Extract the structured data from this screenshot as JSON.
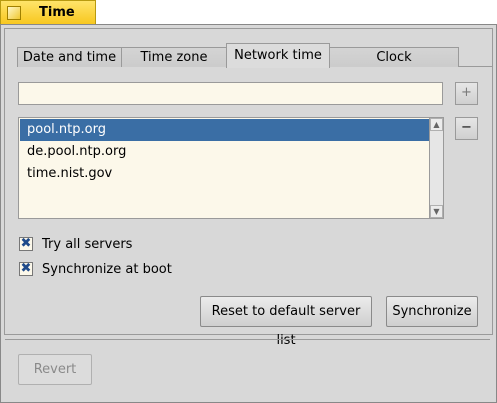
{
  "window": {
    "title": "Time"
  },
  "tabs": [
    {
      "label": "Date and time"
    },
    {
      "label": "Time zone"
    },
    {
      "label": "Network time",
      "active": true
    },
    {
      "label": "Clock"
    }
  ],
  "server_input": {
    "value": "",
    "placeholder": ""
  },
  "add_button": {
    "label": "+"
  },
  "remove_button": {
    "label": "−"
  },
  "servers": [
    {
      "label": "pool.ntp.org",
      "selected": true
    },
    {
      "label": "de.pool.ntp.org",
      "selected": false
    },
    {
      "label": "time.nist.gov",
      "selected": false
    }
  ],
  "options": {
    "try_all": {
      "label": "Try all servers",
      "checked": true,
      "mark": "✖"
    },
    "sync_boot": {
      "label": "Synchronize at boot",
      "checked": true,
      "mark": "✖"
    }
  },
  "actions": {
    "reset_label": "Reset to default server list",
    "sync_label": "Synchronize",
    "revert_label": "Revert"
  },
  "colors": {
    "title_tab": "#f7c61c",
    "selection": "#3a6ea5",
    "field_bg": "#fcf8ea",
    "panel_bg": "#d8d8d8"
  }
}
